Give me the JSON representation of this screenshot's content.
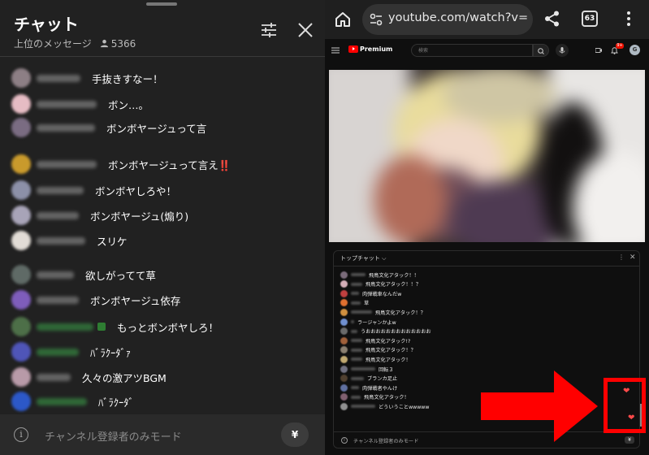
{
  "chat_panel": {
    "title": "チャット",
    "filter_label": "上位のメッセージ",
    "viewer_count": "5366",
    "icons": [
      "sliders-icon",
      "close-icon",
      "person-icon",
      "info-icon"
    ],
    "messages": [
      {
        "text": "手抜きすなー！",
        "avatar_color": "#8d7f85",
        "badge": ""
      },
      {
        "text": "ボン…。",
        "avatar_color": "#e6bcc4",
        "badge": ""
      },
      {
        "text": "ボンボヤージュって言",
        "avatar_color": "#7a6c82",
        "badge": ""
      },
      {
        "text": "ボンボヤージュって言え‼️",
        "avatar_color": "#c99a2c",
        "badge": ""
      },
      {
        "text": "ボンボヤしろや！",
        "avatar_color": "#8c90a8",
        "badge": ""
      },
      {
        "text": "ボンボヤージュ(煽り)",
        "avatar_color": "#a8a4b8",
        "badge": ""
      },
      {
        "text": "スリケ",
        "avatar_color": "#e2dcd6",
        "badge": ""
      },
      {
        "text": "欲しがってて草",
        "avatar_color": "#5f6a66",
        "badge": ""
      },
      {
        "text": "ボンボヤージュ依存",
        "avatar_color": "#7e5dbb",
        "badge": ""
      },
      {
        "text": "もっとボンボヤしろ！",
        "avatar_color": "#4d6f48",
        "badge": "#2e7d32"
      },
      {
        "text": "ﾊﾞﾗｸｰﾀﾞｧ",
        "avatar_color": "#4f55b8",
        "badge": ""
      },
      {
        "text": "久々の激アツBGM",
        "avatar_color": "#b89aa8",
        "badge": ""
      },
      {
        "text": "ﾊﾞﾗｸｰﾀﾞ",
        "avatar_color": "#2c58c8",
        "badge": ""
      }
    ],
    "footer_placeholder": "チャンネル登録者のみモード",
    "superchat_symbol": "¥"
  },
  "browser": {
    "url": "youtube.com/watch?v=N",
    "tab_count": "63",
    "icons": [
      "home-icon",
      "site-settings-icon",
      "share-icon",
      "tab-switcher-icon",
      "more-vert-icon"
    ]
  },
  "youtube": {
    "logo_text": "Premium",
    "search_placeholder": "検索",
    "notification_badge": "9+",
    "account_initial": "G",
    "live_chat": {
      "header_label": "トップチャット ⌵",
      "messages": [
        {
          "text": "飛鳥文化アタック！！",
          "avatar_color": "#7a6b7a"
        },
        {
          "text": "飛鳥文化アタック！！？",
          "avatar_color": "#d4aeb8"
        },
        {
          "text": "肉弾戦車なんだw",
          "avatar_color": "#c04040"
        },
        {
          "text": "草",
          "avatar_color": "#e07030"
        },
        {
          "text": "飛鳥文化アタック！？",
          "avatar_color": "#d09040"
        },
        {
          "text": "ラージャンかよw",
          "avatar_color": "#7090d0"
        },
        {
          "text": "うおおおおおおおおおおおおお",
          "avatar_color": "#6a6a6a"
        },
        {
          "text": "飛鳥文化アタック!?",
          "avatar_color": "#a0603a"
        },
        {
          "text": "飛鳥文化アタック！？",
          "avatar_color": "#8a7f70"
        },
        {
          "text": "飛鳥文化アタック！",
          "avatar_color": "#c0a870"
        },
        {
          "text": "回転３",
          "avatar_color": "#707080"
        },
        {
          "text": "ブランカ足止",
          "avatar_color": "#504030"
        },
        {
          "text": "肉弾戦者やんけ",
          "avatar_color": "#6070a0"
        },
        {
          "text": "飛鳥文化アタック！",
          "avatar_color": "#806070"
        },
        {
          "text": "どういうことwwwww",
          "avatar_color": "#909090"
        }
      ],
      "footer_placeholder": "チャンネル登録者のみモード",
      "superchat_symbol": "¥"
    }
  },
  "annotation": {
    "color": "#ff0000",
    "icons": [
      "red-arrow-icon",
      "heart-icon"
    ]
  }
}
